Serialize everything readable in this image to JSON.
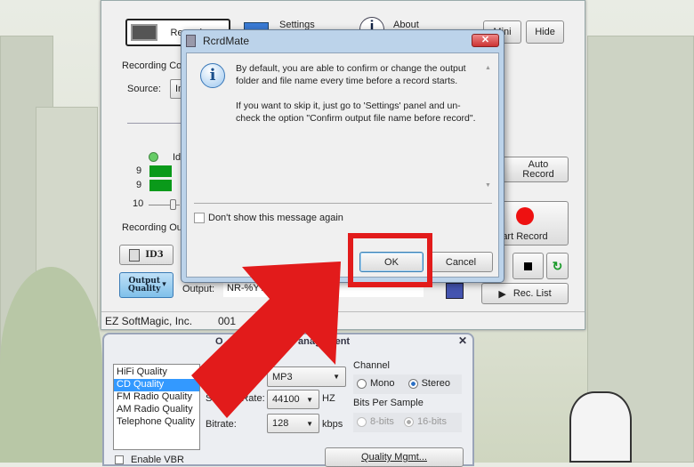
{
  "main_window": {
    "toolbar": {
      "record_label": "Record",
      "settings_label": "Settings",
      "about_label": "About",
      "mini_label": "Mini",
      "hide_label": "Hide"
    },
    "recording_control_label": "Recording Co",
    "source_label": "Source:",
    "source_value": "In",
    "idle_label": "Id",
    "meter_left": "9",
    "meter_right": "9",
    "volume_value": "10",
    "auto_record_label": "Auto Record",
    "recording_output_label": "Recording Ou",
    "id3_label": "ID3",
    "output_quality_label": "Output Quality",
    "output_label": "Output:",
    "output_value": "NR-%Y%",
    "start_record_label": "art Record",
    "rec_list_label": "Rec. List",
    "status_company": "EZ SoftMagic, Inc.",
    "status_count": "001"
  },
  "dialog": {
    "title": "RcrdMate",
    "message_1": "By default, you are able to confirm or change the output folder and file name every time before a record starts.",
    "message_2": "If you want to skip it, just go to 'Settings' panel and un-check the option \"Confirm output file name before record\".",
    "dont_show_label": "Don't show this message again",
    "dont_show_checked": false,
    "ok_label": "OK",
    "cancel_label": "Cancel"
  },
  "quality_window": {
    "title_left": "O",
    "title_right": "anagement",
    "presets": [
      "HiFi Quality",
      "CD Quality",
      "FM Radio Quality",
      "AM Radio Quality",
      "Telephone Quality"
    ],
    "selected_preset": "CD Quality",
    "format_value": "MP3",
    "sample_rate_label": "Sample Rate:",
    "sample_rate_value": "44100",
    "hz_label": "HZ",
    "bitrate_label": "Bitrate:",
    "bitrate_value": "128",
    "kbps_label": "kbps",
    "channel_label": "Channel",
    "mono_label": "Mono",
    "stereo_label": "Stereo",
    "channel_selected": "Stereo",
    "bits_label": "Bits Per Sample",
    "bits8_label": "8-bits",
    "bits16_label": "16-bits",
    "enable_vbr_label": "Enable VBR",
    "quality_mgmt_label": "Quality Mgmt..."
  },
  "colors": {
    "highlight": "#e21b1b",
    "selection": "#3399ff",
    "led_green": "#0a9a1a",
    "record_red": "#ee1111"
  }
}
